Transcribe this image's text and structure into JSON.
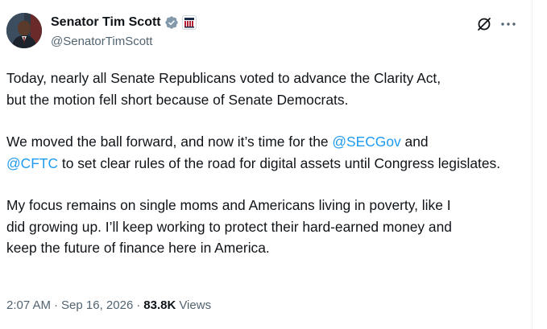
{
  "author": {
    "display_name": "Senator Tim Scott",
    "handle": "@SenatorTimScott",
    "verified_icon": "gray-verified-badge-icon",
    "affiliation_icon": "us-senate-seal-icon",
    "avatar_icon": "profile-photo"
  },
  "header_actions": {
    "grok_icon": "grok-icon",
    "more_icon": "more-options-icon"
  },
  "tweet": {
    "p1": "Today, nearly all Senate Republicans voted to advance the Clarity Act,\nbut the motion fell short because of Senate Democrats.",
    "p2_pre": "We moved the ball forward, and now it’s time for the ",
    "p2_mention1": "@SECGov",
    "p2_mid": " and",
    "p2_mention2": "@CFTC",
    "p2_post": " to set clear rules of the road for digital assets until Congress legislates.",
    "p3": "My focus remains on single moms and Americans living in poverty, like I\ndid growing up. I’ll keep working to protect their hard-earned money and\nkeep the future of finance here in America."
  },
  "meta": {
    "time": "2:07 AM",
    "separator1": "·",
    "date": "Sep 16, 2026",
    "separator2": "·",
    "views_count": "83.8K",
    "views_label": "Views"
  },
  "colors": {
    "text": "#0f1419",
    "secondary": "#536471",
    "link": "#1d9bf0"
  }
}
